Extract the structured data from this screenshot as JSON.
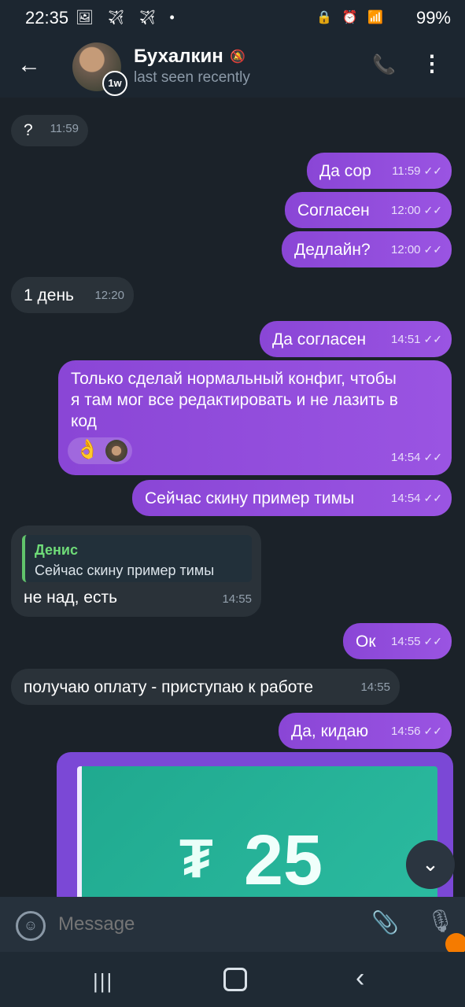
{
  "statusbar": {
    "time": "22:35",
    "left_icons": "🖼 ✈ ✈ •",
    "right_icons": "🔒 ⏰ 📶",
    "battery": "99%"
  },
  "header": {
    "back": "←",
    "name": "Бухалкин",
    "mute": "🔕",
    "status": "last seen recently",
    "badge": "1w",
    "call": "📞",
    "menu": "⋮"
  },
  "messages": [
    {
      "text": "?",
      "time": "11:59"
    },
    {
      "text": "Да сор",
      "time": "11:59"
    },
    {
      "text": "Согласен",
      "time": "12:00"
    },
    {
      "text": "Дедлайн?",
      "time": "12:00"
    },
    {
      "text": "1 день",
      "time": "12:20"
    },
    {
      "text": "Да согласен",
      "time": "14:51"
    },
    {
      "text": "Только сделай нормальный конфиг, чтобы\nя там мог все редактировать и не лазить в\nкод",
      "time": "14:54",
      "reaction": "👌"
    },
    {
      "text": "Сейчас скину пример тимы",
      "time": "14:54"
    },
    {
      "quote_name": "Денис",
      "quote_text": "Сейчас скину пример тимы",
      "text": "не над, есть",
      "time": "14:55"
    },
    {
      "text": "Ок",
      "time": "14:55"
    },
    {
      "text": "получаю оплату - приступаю к работе",
      "time": "14:55"
    },
    {
      "text": "Да, кидаю",
      "time": "14:56"
    }
  ],
  "media": {
    "symbol": "₮",
    "amount": "25",
    "accent": "#2bbba0"
  },
  "checks": "✓✓",
  "scroll_button": "⌄",
  "composer": {
    "placeholder": "Message",
    "emoji": "☺",
    "attach": "📎",
    "mic": "🎙"
  },
  "navbar": {
    "recent": "|||",
    "back": "‹"
  }
}
